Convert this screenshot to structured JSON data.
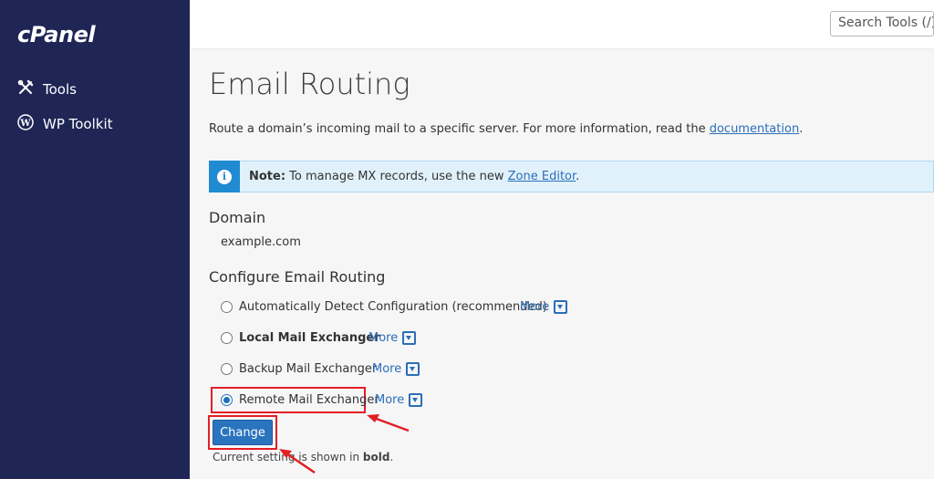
{
  "sidebar": {
    "logo": "cPanel",
    "items": [
      {
        "label": "Tools",
        "icon": "tools-icon"
      },
      {
        "label": "WP Toolkit",
        "icon": "wordpress-icon"
      }
    ]
  },
  "header": {
    "search_placeholder": "Search Tools (/)"
  },
  "page": {
    "title": "Email Routing",
    "intro_text": "Route a domain’s incoming mail to a specific server. For more information, read the ",
    "intro_link": "documentation",
    "intro_end": ".",
    "note_label": "Note:",
    "note_text": " To manage MX records, use the new ",
    "note_link": "Zone Editor",
    "note_end": ".",
    "domain_heading": "Domain",
    "domain_value": "example.com",
    "routing_heading": "Configure Email Routing",
    "options": [
      {
        "label": "Automatically Detect Configuration (recommended)",
        "more": "More",
        "checked": false,
        "bold": false
      },
      {
        "label": "Local Mail Exchanger",
        "more": "More",
        "checked": false,
        "bold": true
      },
      {
        "label": "Backup Mail Exchanger",
        "more": "More",
        "checked": false,
        "bold": false
      },
      {
        "label": "Remote Mail Exchanger",
        "more": "More",
        "checked": true,
        "bold": false
      }
    ],
    "change_button": "Change",
    "footnote_prefix": "Current setting is shown in ",
    "footnote_bold": "bold",
    "footnote_end": "."
  },
  "colors": {
    "sidebar_bg": "#1f2656",
    "accent_blue": "#2a74be",
    "highlight_red": "#e31e24",
    "note_bg": "#e1f1fb"
  }
}
